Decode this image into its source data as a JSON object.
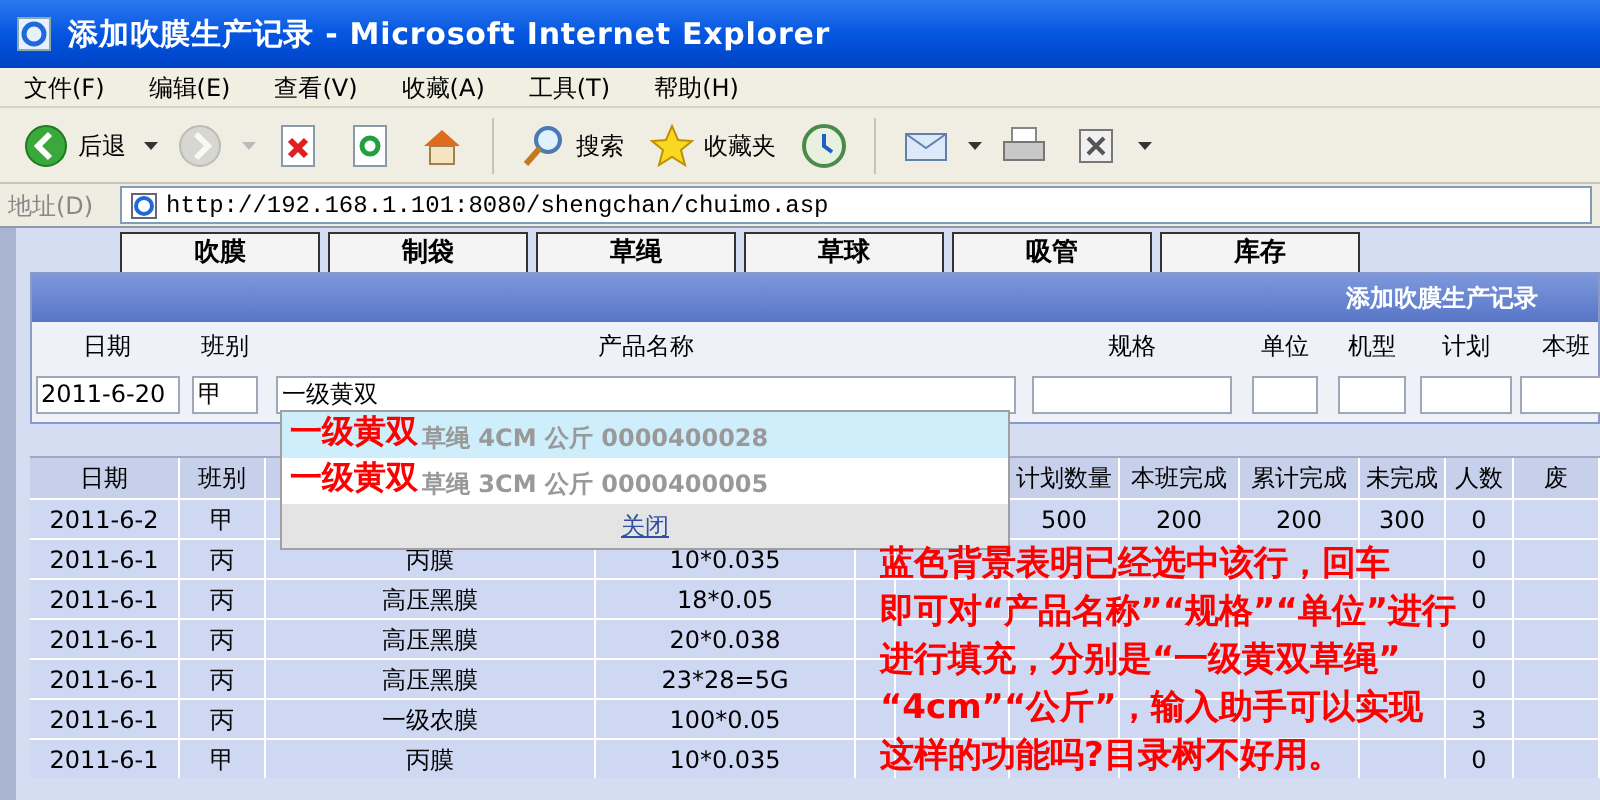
{
  "window": {
    "title": "添加吹膜生产记录 - Microsoft Internet Explorer"
  },
  "menu": [
    "文件(F)",
    "编辑(E)",
    "查看(V)",
    "收藏(A)",
    "工具(T)",
    "帮助(H)"
  ],
  "toolbar": [
    {
      "kind": "back",
      "label": "后退",
      "caret": true,
      "disabled": false
    },
    {
      "kind": "forward",
      "caret": true,
      "disabled": true
    },
    {
      "kind": "stop",
      "caret": false,
      "disabled": false
    },
    {
      "kind": "refresh",
      "caret": false,
      "disabled": false
    },
    {
      "kind": "home",
      "caret": false,
      "disabled": false
    },
    {
      "kind": "search",
      "label": "搜索",
      "caret": false,
      "disabled": false
    },
    {
      "kind": "favorites",
      "label": "收藏夹",
      "caret": false,
      "disabled": false
    },
    {
      "kind": "history",
      "caret": false,
      "disabled": false
    },
    {
      "kind": "mail",
      "caret": true,
      "disabled": false
    },
    {
      "kind": "print",
      "caret": false,
      "disabled": false
    },
    {
      "kind": "edit",
      "caret": true,
      "disabled": false
    }
  ],
  "address": {
    "label": "地址(D)",
    "url": "http://192.168.1.101:8080/shengchan/chuimo.asp"
  },
  "nav_tabs": [
    "吹膜",
    "制袋",
    "草绳",
    "草球",
    "吸管",
    "库存"
  ],
  "form": {
    "title": "添加吹膜生产记录",
    "fields": [
      {
        "label": "日期",
        "value": "2011-6-20"
      },
      {
        "label": "班别",
        "value": "甲"
      },
      {
        "label": "产品名称",
        "value": "一级黄双"
      },
      {
        "label": "规格"
      },
      {
        "label": "单位"
      },
      {
        "label": "机型"
      },
      {
        "label": "计划"
      },
      {
        "label": "本班"
      }
    ]
  },
  "autocomplete": {
    "items": [
      {
        "match": "一级黄双",
        "rest": "草绳 4CM 公斤 0000400028",
        "selected": true
      },
      {
        "match": "一级黄双",
        "rest": "草绳 3CM 公斤 0000400005",
        "selected": false
      }
    ],
    "close": "关闭"
  },
  "table": {
    "columns": [
      {
        "label": "日期"
      },
      {
        "label": "班别"
      },
      {},
      {},
      {},
      {},
      {
        "label": "计划数量"
      },
      {
        "label": "本班完成"
      },
      {
        "label": "累计完成"
      },
      {
        "label": "未完成"
      },
      {
        "label": "人数"
      },
      {
        "label": "废"
      }
    ],
    "rows": [
      {
        "cells": [
          "2011-6-2",
          "甲",
          null,
          null,
          null,
          null,
          "500",
          "200",
          "200",
          "300",
          "0",
          null
        ]
      },
      {
        "cells": [
          "2011-6-1",
          "丙",
          "丙膜",
          "10*0.035",
          null,
          null,
          null,
          null,
          null,
          null,
          "0",
          null
        ]
      },
      {
        "cells": [
          "2011-6-1",
          "丙",
          "高压黑膜",
          "18*0.05",
          null,
          null,
          null,
          null,
          null,
          null,
          "0",
          null
        ]
      },
      {
        "cells": [
          "2011-6-1",
          "丙",
          "高压黑膜",
          "20*0.038",
          null,
          null,
          null,
          null,
          null,
          null,
          "0",
          null
        ]
      },
      {
        "cells": [
          "2011-6-1",
          "丙",
          "高压黑膜",
          "23*28=5G",
          null,
          null,
          null,
          null,
          null,
          null,
          "0",
          null
        ]
      },
      {
        "cells": [
          "2011-6-1",
          "丙",
          "一级农膜",
          "100*0.05",
          null,
          null,
          null,
          null,
          null,
          null,
          "3",
          null
        ]
      },
      {
        "cells": [
          "2011-6-1",
          "甲",
          "丙膜",
          "10*0.035",
          null,
          null,
          null,
          null,
          null,
          null,
          "0",
          null
        ]
      }
    ]
  },
  "note": {
    "lines": [
      "蓝色背景表明已经选中该行，回车",
      "即可对“产品名称”“规格”“单位”进行",
      "进行填充，分别是“一级黄双草绳”",
      "“4cm”“公斤”，输入助手可以实现",
      "这样的功能吗?目录树不好用。"
    ]
  }
}
